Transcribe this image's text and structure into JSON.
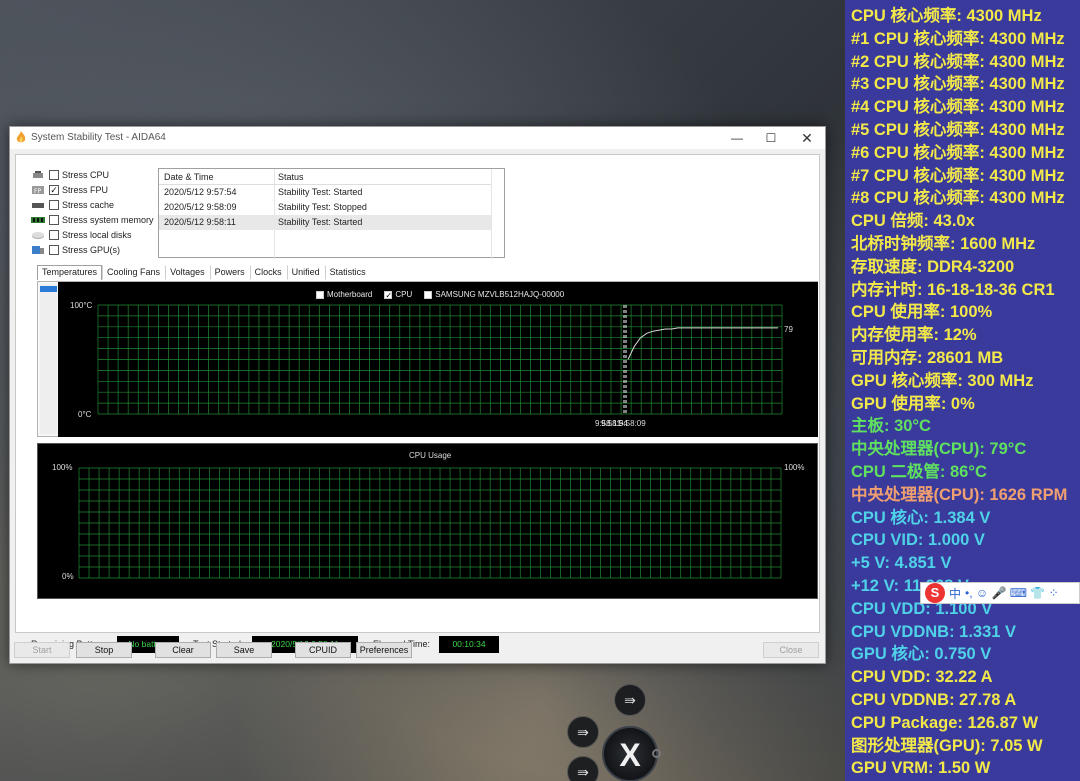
{
  "window": {
    "title": "System Stability Test - AIDA64",
    "min_glyph": "—",
    "max_glyph": "☐",
    "close_glyph": "✕"
  },
  "stress_options": [
    {
      "label": "Stress CPU",
      "checked": false,
      "icon": "cpu-chip-icon"
    },
    {
      "label": "Stress FPU",
      "checked": true,
      "icon": "fpu-icon"
    },
    {
      "label": "Stress cache",
      "checked": false,
      "icon": "cache-chip-icon"
    },
    {
      "label": "Stress system memory",
      "checked": false,
      "icon": "memory-module-icon"
    },
    {
      "label": "Stress local disks",
      "checked": false,
      "icon": "disk-drive-icon"
    },
    {
      "label": "Stress GPU(s)",
      "checked": false,
      "icon": "gpu-icon"
    }
  ],
  "log": {
    "headers": [
      "Date & Time",
      "Status"
    ],
    "rows": [
      {
        "datetime": "2020/5/12 9:57:54",
        "status": "Stability Test: Started"
      },
      {
        "datetime": "2020/5/12 9:58:09",
        "status": "Stability Test: Stopped"
      },
      {
        "datetime": "2020/5/12 9:58:11",
        "status": "Stability Test: Started"
      }
    ]
  },
  "tabs": [
    "Temperatures",
    "Cooling Fans",
    "Voltages",
    "Powers",
    "Clocks",
    "Unified",
    "Statistics"
  ],
  "active_tab": "Temperatures",
  "temp_graph": {
    "legend": [
      {
        "label": "Motherboard",
        "checked": false
      },
      {
        "label": "CPU",
        "checked": true
      },
      {
        "label": "SAMSUNG MZVLB512HAJQ-00000",
        "checked": false
      }
    ],
    "y_top": "100°C",
    "y_bottom": "0°C",
    "current_value": "79",
    "x_label": "9:58:11",
    "x_label_overlap": "9:58:09",
    "x_label_overlap2": "9:58:54",
    "line_color": "#d8d8d8",
    "grid_color": "#1f8a32"
  },
  "usage_graph": {
    "title": "CPU Usage",
    "y_top_left": "100%",
    "y_top_right": "100%",
    "y_bottom": "0%"
  },
  "chart_data": {
    "type": "line",
    "title": "",
    "series": [
      {
        "name": "CPU",
        "values": [
          50,
          62,
          70,
          74,
          76,
          77,
          78,
          78,
          79,
          79,
          79,
          79,
          79,
          79,
          79,
          79,
          79,
          79,
          79,
          79,
          79,
          79,
          79,
          79,
          79
        ]
      }
    ],
    "ylim": [
      0,
      100
    ],
    "ylabel": "°C",
    "xlabel": ""
  },
  "status": {
    "battery_label": "Remaining Battery:",
    "battery_value": "No battery",
    "started_label": "Test Started:",
    "started_value": "2020/5/12 9:58:11",
    "elapsed_label": "Elapsed Time:",
    "elapsed_value": "00:10:34"
  },
  "buttons": {
    "start": "Start",
    "stop": "Stop",
    "clear": "Clear",
    "save": "Save",
    "cpuid": "CPUID",
    "preferences": "Preferences",
    "close": "Close"
  },
  "osd": [
    {
      "text": "CPU 核心频率: 4300 MHz",
      "color": "#f2e84a"
    },
    {
      "text": "#1 CPU 核心频率: 4300 MHz",
      "color": "#f2e84a"
    },
    {
      "text": "#2 CPU 核心频率: 4300 MHz",
      "color": "#f2e84a"
    },
    {
      "text": "#3 CPU 核心频率: 4300 MHz",
      "color": "#f2e84a"
    },
    {
      "text": "#4 CPU 核心频率: 4300 MHz",
      "color": "#f2e84a"
    },
    {
      "text": "#5 CPU 核心频率: 4300 MHz",
      "color": "#f2e84a"
    },
    {
      "text": "#6 CPU 核心频率: 4300 MHz",
      "color": "#f2e84a"
    },
    {
      "text": "#7 CPU 核心频率: 4300 MHz",
      "color": "#f2e84a"
    },
    {
      "text": "#8 CPU 核心频率: 4300 MHz",
      "color": "#f2e84a"
    },
    {
      "text": "CPU 倍频: 43.0x",
      "color": "#f2e84a"
    },
    {
      "text": "北桥时钟频率: 1600 MHz",
      "color": "#f2e84a"
    },
    {
      "text": "存取速度: DDR4-3200",
      "color": "#f2e84a"
    },
    {
      "text": "内存计时: 16-18-18-36 CR1",
      "color": "#f2e84a"
    },
    {
      "text": "CPU 使用率: 100%",
      "color": "#f2e84a"
    },
    {
      "text": "内存使用率: 12%",
      "color": "#f2e84a"
    },
    {
      "text": "可用内存: 28601 MB",
      "color": "#f2e84a"
    },
    {
      "text": "GPU 核心频率: 300 MHz",
      "color": "#f2e84a"
    },
    {
      "text": "GPU 使用率: 0%",
      "color": "#f2e84a"
    },
    {
      "text": "主板: 30°C",
      "color": "#5fe05f"
    },
    {
      "text": "中央处理器(CPU): 79°C",
      "color": "#5fe05f"
    },
    {
      "text": "CPU 二极管: 86°C",
      "color": "#5fe05f"
    },
    {
      "text": "中央处理器(CPU): 1626 RPM",
      "color": "#f0a070"
    },
    {
      "text": "CPU 核心: 1.384 V",
      "color": "#4fd2e8"
    },
    {
      "text": "CPU VID: 1.000 V",
      "color": "#4fd2e8"
    },
    {
      "text": "+5 V: 4.851 V",
      "color": "#4fd2e8"
    },
    {
      "text": "+12 V: 11.968 V",
      "color": "#4fd2e8"
    },
    {
      "text": "CPU VDD: 1.100 V",
      "color": "#4fd2e8"
    },
    {
      "text": "CPU VDDNB: 1.331 V",
      "color": "#4fd2e8"
    },
    {
      "text": "GPU 核心: 0.750 V",
      "color": "#4fd2e8"
    },
    {
      "text": "CPU VDD: 32.22 A",
      "color": "#f2e84a"
    },
    {
      "text": "CPU VDDNB: 27.78 A",
      "color": "#f2e84a"
    },
    {
      "text": "CPU Package: 126.87 W",
      "color": "#f2e84a"
    },
    {
      "text": "图形处理器(GPU): 7.05 W",
      "color": "#f2e84a"
    },
    {
      "text": "GPU VRM: 1.50 W",
      "color": "#f2e84a"
    }
  ],
  "ime": {
    "logo": "S",
    "lang": "中",
    "icons": "•, ☺ 🎤 ⌨ 👕 ⁘"
  },
  "fabs": {
    "top": "⇛",
    "left": "⇛",
    "bottom": "⇛",
    "main": "X"
  }
}
